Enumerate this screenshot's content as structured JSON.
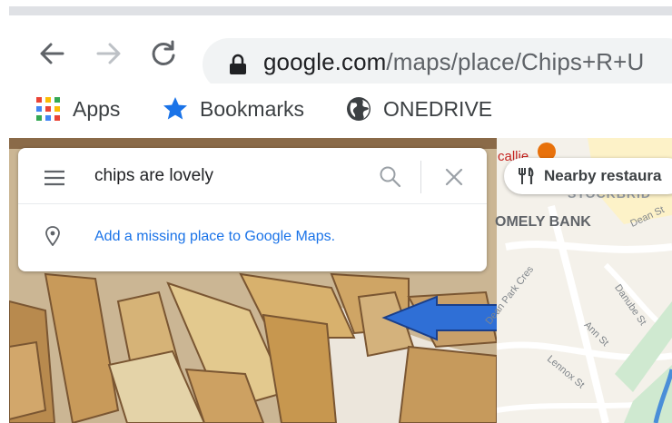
{
  "browser": {
    "url_domain": "google.com",
    "url_path": "/maps/place/Chips+R+U",
    "bookmarks": [
      {
        "label": "Apps",
        "icon": "apps-grid-icon"
      },
      {
        "label": "Bookmarks",
        "icon": "star-icon"
      },
      {
        "label": "ONEDRIVE",
        "icon": "globe-icon"
      }
    ]
  },
  "search": {
    "query": "chips are lovely",
    "add_place": "Add a missing place to Google Maps."
  },
  "map": {
    "nearby_label": "Nearby restaura",
    "top_place": "callie",
    "labels": {
      "stockbridge": "STOCKBRID",
      "comely_bank": "OMELY BANK",
      "dean_st": "Dean St",
      "dean_park_cres": "Dean Park Cres",
      "danube_st": "Danube St",
      "ann_st": "Ann St",
      "lennox_st": "Lennox St"
    }
  },
  "colors": {
    "arrow": "#2f6fd6",
    "link": "#1a73e8",
    "star": "#1a73e8"
  }
}
